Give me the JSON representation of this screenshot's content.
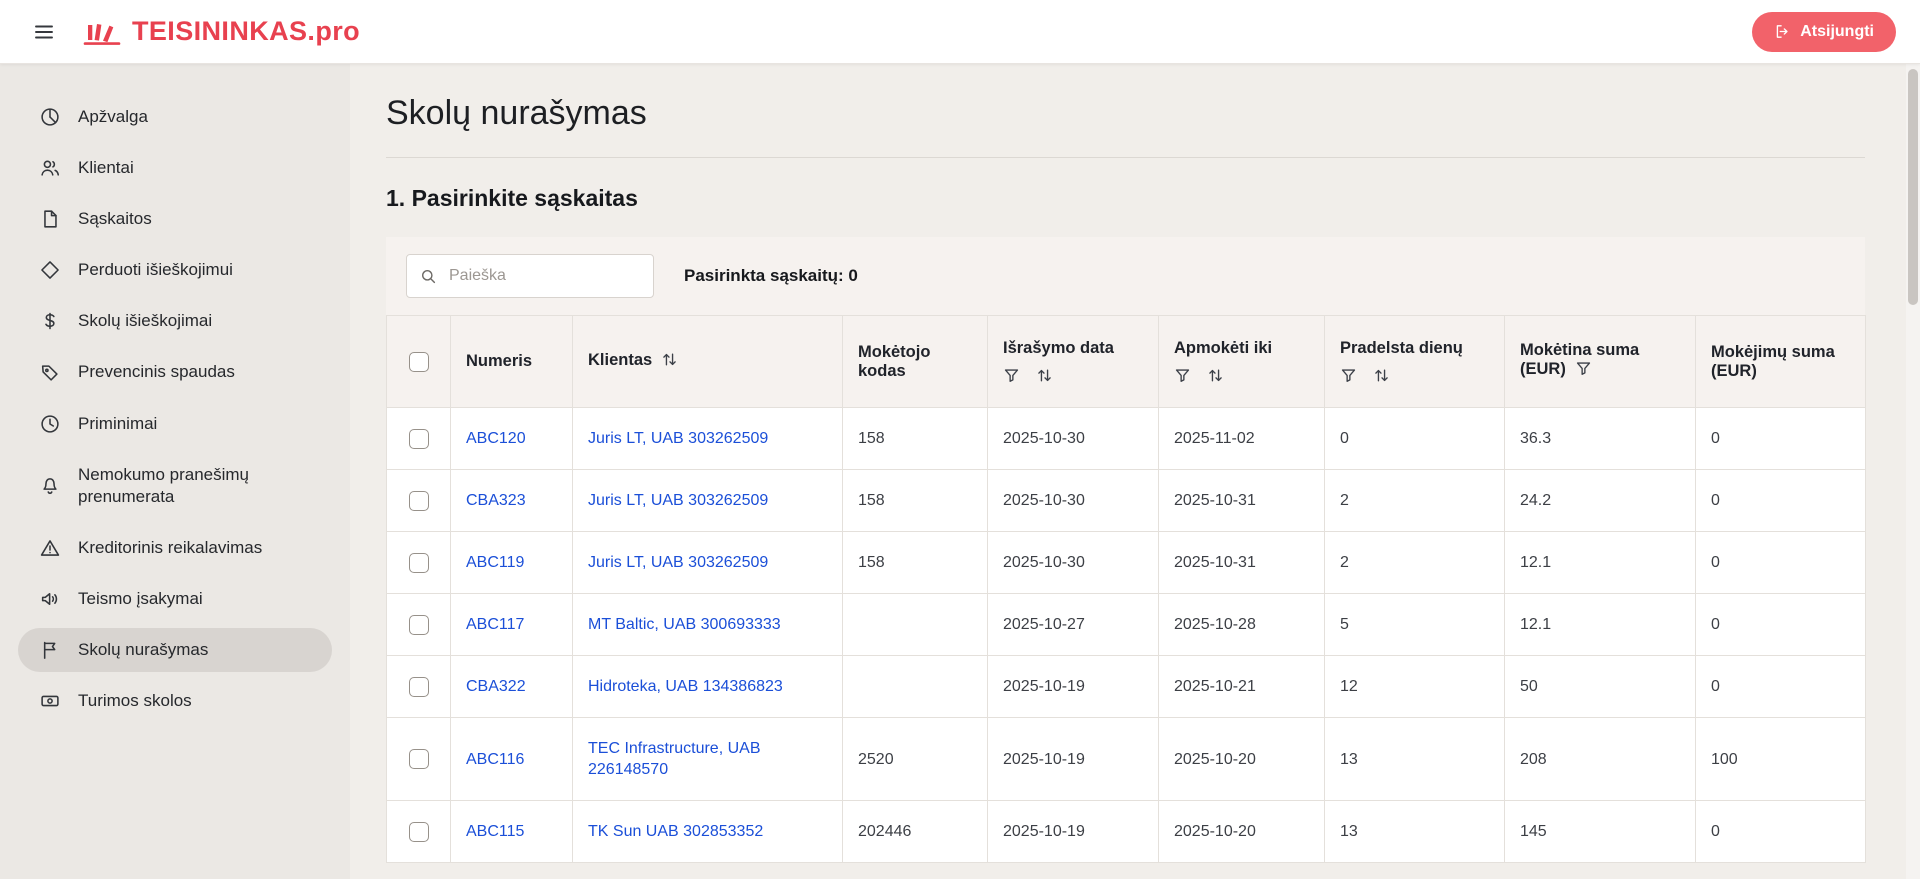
{
  "header": {
    "logo_text": "TEISININKAS.pro",
    "logout_label": "Atsijungti"
  },
  "sidebar": {
    "items": [
      {
        "id": "apzvalga",
        "label": "Apžvalga",
        "icon": "overview-icon",
        "active": false
      },
      {
        "id": "klientai",
        "label": "Klientai",
        "icon": "clients-icon",
        "active": false
      },
      {
        "id": "saskaitos",
        "label": "Sąskaitos",
        "icon": "invoices-icon",
        "active": false
      },
      {
        "id": "perduoti-isieskojimui",
        "label": "Perduoti išieškojimui",
        "icon": "transfer-icon",
        "active": false
      },
      {
        "id": "skolu-isieskojimai",
        "label": "Skolų išieškojimai",
        "icon": "money-icon",
        "active": false
      },
      {
        "id": "prevencinis-spaudas",
        "label": "Prevencinis spaudas",
        "icon": "tag-icon",
        "active": false
      },
      {
        "id": "priminimai",
        "label": "Priminimai",
        "icon": "clock-icon",
        "active": false
      },
      {
        "id": "nemokumo-pranesimu-prenumerata",
        "label": "Nemokumo pranešimų prenumerata",
        "icon": "bell-icon",
        "active": false
      },
      {
        "id": "kreditorinis-reikalavimas",
        "label": "Kreditorinis reikalavimas",
        "icon": "warning-icon",
        "active": false
      },
      {
        "id": "teismo-isakymai",
        "label": "Teismo įsakymai",
        "icon": "announcement-icon",
        "active": false
      },
      {
        "id": "skolu-nurasymas",
        "label": "Skolų nurašymas",
        "icon": "flag-icon",
        "active": true
      },
      {
        "id": "turimos-skolos",
        "label": "Turimos skolos",
        "icon": "banknote-icon",
        "active": false
      }
    ]
  },
  "main": {
    "page_title": "Skolų nurašymas",
    "section_title": "1. Pasirinkite sąskaitas",
    "search": {
      "placeholder": "Paieška"
    },
    "selected_count_label": "Pasirinkta sąskaitų: 0",
    "table": {
      "columns": [
        {
          "key": "select",
          "type": "checkbox"
        },
        {
          "key": "numeris",
          "label": "Numeris",
          "link": true
        },
        {
          "key": "klientas",
          "label": "Klientas",
          "link": true,
          "inline_icons": [
            "sort"
          ]
        },
        {
          "key": "moketojo_kodas",
          "label": "Mokėtojo kodas"
        },
        {
          "key": "israsymo_data",
          "label": "Išrašymo data",
          "icons_below": [
            "filter",
            "sort"
          ]
        },
        {
          "key": "apmoketi_iki",
          "label": "Apmokėti iki",
          "icons_below": [
            "filter",
            "sort"
          ]
        },
        {
          "key": "pradelsta_dienu",
          "label": "Pradelsta dienų",
          "icons_below": [
            "filter",
            "sort"
          ]
        },
        {
          "key": "moketina_suma",
          "label": "Mokėtina suma (EUR)",
          "inline_icons": [
            "filter"
          ]
        },
        {
          "key": "mokejimu_suma",
          "label": "Mokėjimų suma (EUR)"
        }
      ],
      "rows": [
        {
          "numeris": "ABC120",
          "klientas": "Juris LT, UAB 303262509",
          "moketojo_kodas": "158",
          "israsymo_data": "2025-10-30",
          "apmoketi_iki": "2025-11-02",
          "pradelsta_dienu": "0",
          "moketina_suma": "36.3",
          "mokejimu_suma": "0"
        },
        {
          "numeris": "CBA323",
          "klientas": "Juris LT, UAB 303262509",
          "moketojo_kodas": "158",
          "israsymo_data": "2025-10-30",
          "apmoketi_iki": "2025-10-31",
          "pradelsta_dienu": "2",
          "moketina_suma": "24.2",
          "mokejimu_suma": "0"
        },
        {
          "numeris": "ABC119",
          "klientas": "Juris LT, UAB 303262509",
          "moketojo_kodas": "158",
          "israsymo_data": "2025-10-30",
          "apmoketi_iki": "2025-10-31",
          "pradelsta_dienu": "2",
          "moketina_suma": "12.1",
          "mokejimu_suma": "0"
        },
        {
          "numeris": "ABC117",
          "klientas": "MT Baltic, UAB 300693333",
          "moketojo_kodas": "",
          "israsymo_data": "2025-10-27",
          "apmoketi_iki": "2025-10-28",
          "pradelsta_dienu": "5",
          "moketina_suma": "12.1",
          "mokejimu_suma": "0"
        },
        {
          "numeris": "CBA322",
          "klientas": "Hidroteka, UAB 134386823",
          "moketojo_kodas": "",
          "israsymo_data": "2025-10-19",
          "apmoketi_iki": "2025-10-21",
          "pradelsta_dienu": "12",
          "moketina_suma": "50",
          "mokejimu_suma": "0"
        },
        {
          "numeris": "ABC116",
          "klientas": "TEC Infrastructure, UAB 226148570",
          "moketojo_kodas": "2520",
          "israsymo_data": "2025-10-19",
          "apmoketi_iki": "2025-10-20",
          "pradelsta_dienu": "13",
          "moketina_suma": "208",
          "mokejimu_suma": "100"
        },
        {
          "numeris": "ABC115",
          "klientas": "TK Sun UAB 302853352",
          "moketojo_kodas": "202446",
          "israsymo_data": "2025-10-19",
          "apmoketi_iki": "2025-10-20",
          "pradelsta_dienu": "13",
          "moketina_suma": "145",
          "mokejimu_suma": "0"
        }
      ]
    }
  },
  "colors": {
    "brand_red": "#e8414f",
    "logout_button": "#f2626a",
    "link_blue": "#1b4fd8"
  }
}
